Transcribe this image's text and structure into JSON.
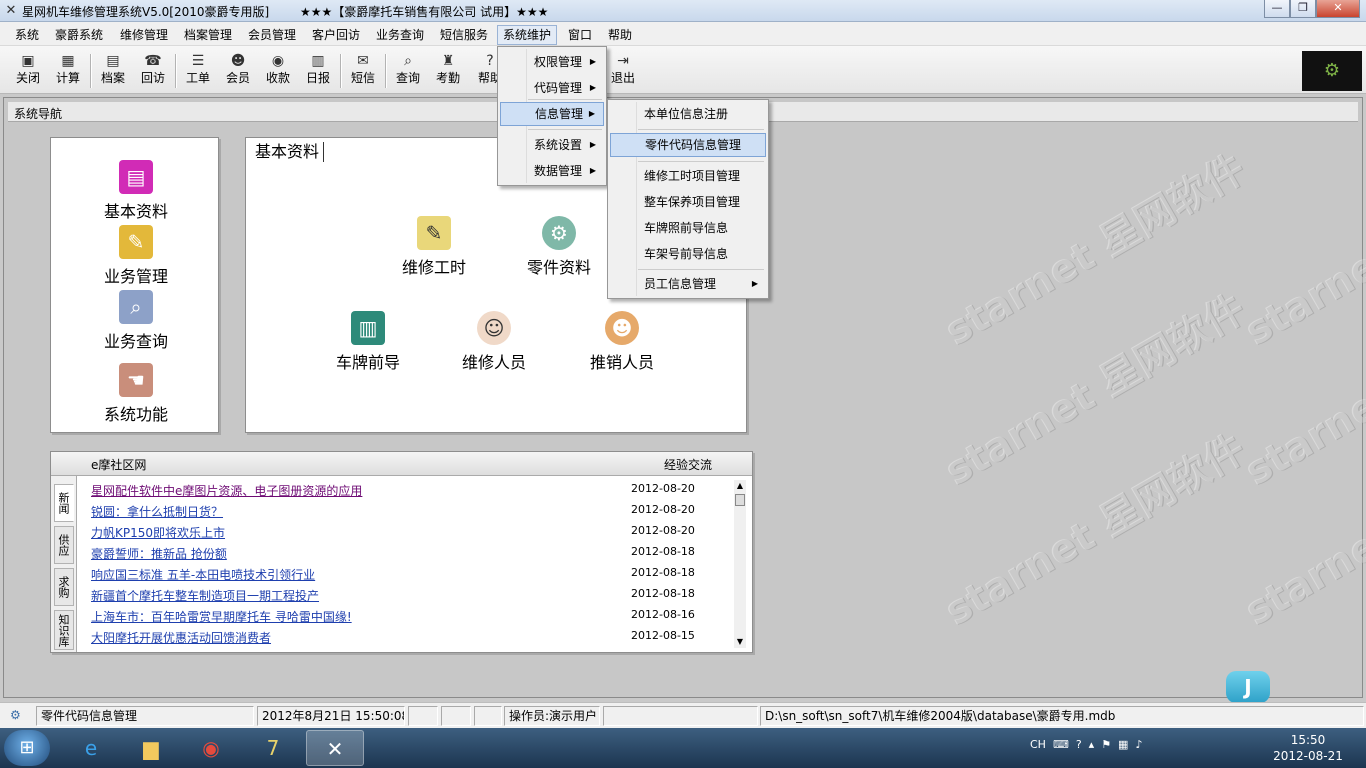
{
  "window": {
    "title": "星网机车维修管理系统V5.0[2010豪爵专用版]",
    "subtitle": "★★★【豪爵摩托车销售有限公司 试用】★★★",
    "min": "—",
    "max": "❐",
    "close": "✕"
  },
  "menubar": [
    "系统",
    "豪爵系统",
    "维修管理",
    "档案管理",
    "会员管理",
    "客户回访",
    "业务查询",
    "短信服务",
    "系统维护",
    "窗口",
    "帮助"
  ],
  "toolbar": [
    {
      "label": "关闭",
      "icon": "close-door-icon",
      "glyph": "▣"
    },
    {
      "label": "计算",
      "icon": "calculator-icon",
      "glyph": "▦"
    },
    {
      "label": "档案",
      "icon": "archive-icon",
      "glyph": "▤"
    },
    {
      "label": "回访",
      "icon": "revisit-icon",
      "glyph": "☎"
    },
    {
      "label": "工单",
      "icon": "work-order-icon",
      "glyph": "☰"
    },
    {
      "label": "会员",
      "icon": "member-icon",
      "glyph": "☻"
    },
    {
      "label": "收款",
      "icon": "money-bag-icon",
      "glyph": "◉"
    },
    {
      "label": "日报",
      "icon": "daily-report-icon",
      "glyph": "▥"
    },
    {
      "label": "短信",
      "icon": "sms-icon",
      "glyph": "✉"
    },
    {
      "label": "查询",
      "icon": "search-icon",
      "glyph": "⌕"
    },
    {
      "label": "考勤",
      "icon": "attendance-icon",
      "glyph": "♜"
    },
    {
      "label": "帮助",
      "icon": "help-icon",
      "glyph": "?"
    },
    {
      "label": "退出",
      "icon": "exit-icon",
      "glyph": "⇥"
    }
  ],
  "nav": {
    "header": "系统导航",
    "left_items": [
      "基本资料",
      "业务管理",
      "业务查询",
      "系统功能"
    ],
    "panel_title": "基本资料",
    "panel_items": [
      "维修工时",
      "零件资料",
      "车牌前导",
      "维修人员",
      "推销人员"
    ]
  },
  "news": {
    "left_header": "e摩社区网",
    "right_header": "经验交流",
    "tabs": [
      "新闻",
      "供应",
      "求购",
      "知识库"
    ],
    "rows": [
      {
        "title": "星网配件软件中e摩图片资源、电子图册资源的应用",
        "date": "2012-08-20"
      },
      {
        "title": "锐圆：拿什么抵制日货？",
        "date": "2012-08-20"
      },
      {
        "title": "力帆KP150即将欢乐上市",
        "date": "2012-08-20"
      },
      {
        "title": "豪爵誓师：推新品 抢份额",
        "date": "2012-08-18"
      },
      {
        "title": "响应国三标准 五羊-本田电喷技术引领行业",
        "date": "2012-08-18"
      },
      {
        "title": "新疆首个摩托车整车制造项目一期工程投产",
        "date": "2012-08-18"
      },
      {
        "title": "上海车市：百年哈雷赏早期摩托车 寻哈雷中国缘!",
        "date": "2012-08-16"
      },
      {
        "title": "大阳摩托开展优惠活动回馈消费者",
        "date": "2012-08-15"
      }
    ]
  },
  "menu_system_maintenance": [
    {
      "label": "权限管理",
      "submenu": true
    },
    {
      "label": "代码管理",
      "submenu": true
    },
    {
      "label": "信息管理",
      "submenu": true,
      "highlighted": true
    },
    {
      "label": "系统设置",
      "submenu": true
    },
    {
      "label": "数据管理",
      "submenu": true
    }
  ],
  "menu_info_management": [
    {
      "label": "本单位信息注册"
    },
    {
      "label": "零件代码信息管理",
      "highlighted": true
    },
    {
      "label": "维修工时项目管理"
    },
    {
      "label": "整车保养项目管理"
    },
    {
      "label": "车牌照前导信息"
    },
    {
      "label": "车架号前导信息"
    },
    {
      "label": "员工信息管理",
      "submenu": true
    }
  ],
  "statusbar": {
    "current": "零件代码信息管理",
    "datetime": "2012年8月21日 15:50:08",
    "operator": "操作员:演示用户",
    "db_path": "D:\\sn_soft\\sn_soft7\\机车维修2004版\\database\\豪爵专用.mdb"
  },
  "floating_button": "J",
  "watermark": "starnet 星网软件",
  "taskbar": {
    "lang": "CH",
    "time": "15:50",
    "date": "2012-08-21"
  },
  "colors": {
    "accent": "#cfe0f5",
    "link": "#1e3fae",
    "visited_link": "#6e0b74"
  }
}
